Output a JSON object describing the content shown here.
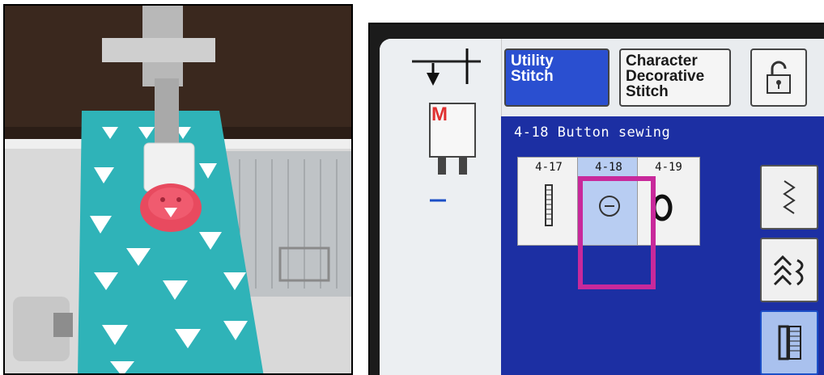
{
  "screen": {
    "tabs": {
      "utility_label_1": "Utility",
      "utility_label_2": "Stitch",
      "character_label_1": "Character",
      "character_label_2": "Decorative",
      "character_label_3": "Stitch"
    },
    "foot_label": "M",
    "panel_title": "4-18  Button sewing",
    "stitches": [
      {
        "number": "4-17"
      },
      {
        "number": "4-18",
        "selected": true
      },
      {
        "number": "4-19"
      }
    ]
  },
  "colors": {
    "panel_blue": "#1c2fa3",
    "tab_active_blue": "#2a4fd0",
    "highlight_magenta": "#c8299b",
    "fabric_teal": "#2fb3b8",
    "button_red": "#e84a5f"
  }
}
